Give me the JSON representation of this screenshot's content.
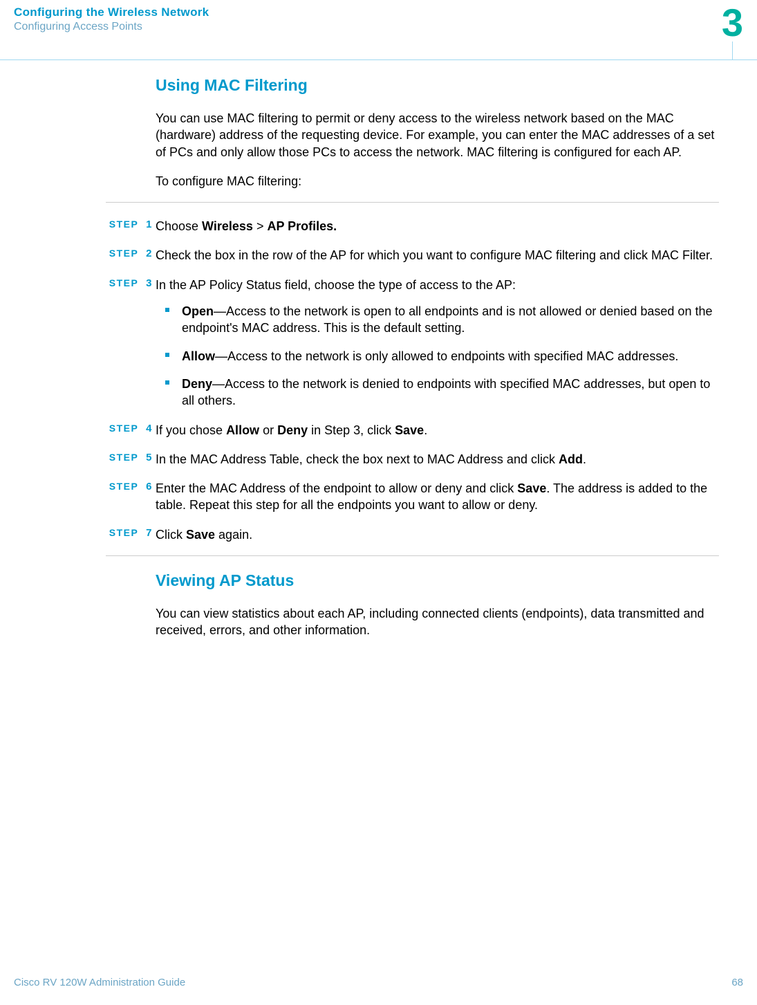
{
  "header": {
    "title": "Configuring the Wireless Network",
    "subtitle": "Configuring Access Points",
    "chapter_number": "3"
  },
  "section1": {
    "heading": "Using MAC Filtering",
    "intro": "You can use MAC filtering to permit or deny access to the wireless network based on the MAC (hardware) address of the requesting device. For example, you can enter the MAC addresses of a set of PCs and only allow those PCs to access the network. MAC filtering is configured for each AP.",
    "lead": "To configure MAC filtering:"
  },
  "steps": [
    {
      "label": "STEP",
      "num": "1",
      "pre": "Choose ",
      "b1": "Wireless",
      "mid1": " > ",
      "b2": "AP Profiles.",
      "post": ""
    },
    {
      "label": "STEP",
      "num": "2",
      "text": "Check the box in the row of the AP for which you want to configure MAC filtering and click MAC Filter."
    },
    {
      "label": "STEP",
      "num": "3",
      "text": "In the AP Policy Status field, choose the type of access to the AP:",
      "subs": [
        {
          "b": "Open",
          "rest": "—Access to the network is open to all endpoints and is not allowed or denied based on the endpoint's MAC address. This is the default setting."
        },
        {
          "b": "Allow",
          "rest": "—Access to the network is only allowed to endpoints with specified MAC addresses."
        },
        {
          "b": "Deny",
          "rest": "—Access to the network is denied to endpoints with specified MAC addresses, but open to all others."
        }
      ]
    },
    {
      "label": "STEP",
      "num": "4",
      "pre": "If you chose ",
      "b1": "Allow",
      "mid1": " or ",
      "b2": "Deny",
      "mid2": " in Step 3, click ",
      "b3": "Save",
      "post": "."
    },
    {
      "label": "STEP",
      "num": "5",
      "pre": "In the MAC Address Table, check the box next to MAC Address and click ",
      "b1": "Add",
      "post": "."
    },
    {
      "label": "STEP",
      "num": "6",
      "pre": "Enter the MAC Address of the endpoint to allow or deny and click ",
      "b1": "Save",
      "post": ". The address is added to the table. Repeat this step for all the endpoints you want to allow or deny."
    },
    {
      "label": "STEP",
      "num": "7",
      "pre": "Click ",
      "b1": "Save",
      "post": " again."
    }
  ],
  "section2": {
    "heading": "Viewing AP Status",
    "intro": "You can view statistics about each AP, including connected clients (endpoints), data transmitted and received, errors, and other information."
  },
  "footer": {
    "guide": "Cisco RV 120W Administration Guide",
    "page": "68"
  }
}
